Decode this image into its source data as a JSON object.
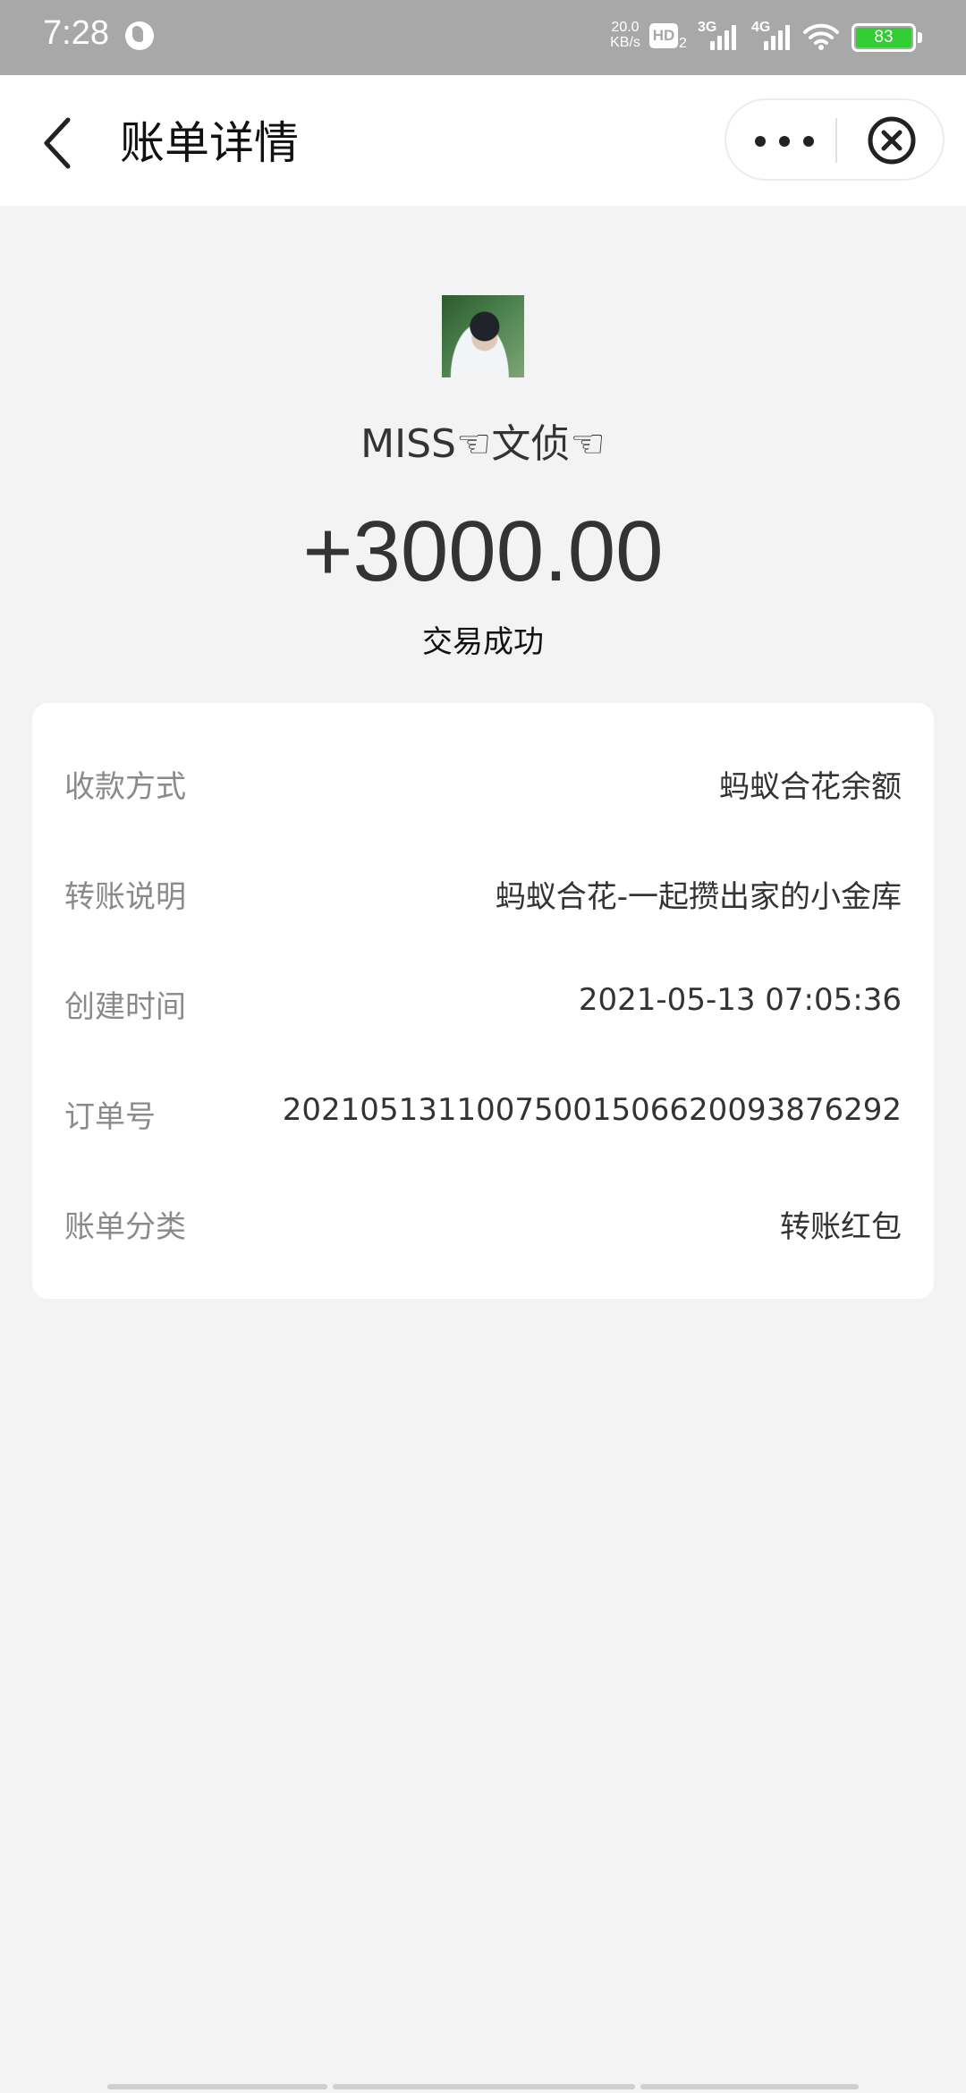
{
  "status_bar": {
    "time": "7:28",
    "net_speed_value": "20.0",
    "net_speed_unit": "KB/s",
    "hd_label": "HD",
    "hd_sub": "2",
    "signal_1": "3G",
    "signal_2": "4G",
    "battery": "83"
  },
  "nav": {
    "title": "账单详情"
  },
  "header": {
    "nickname": "MISS☜文侦☜",
    "amount": "+3000.00",
    "status": "交易成功"
  },
  "details": [
    {
      "label": "收款方式",
      "value": "蚂蚁合花余额"
    },
    {
      "label": "转账说明",
      "value": "蚂蚁合花-一起攒出家的小金库"
    },
    {
      "label": "创建时间",
      "value": "2021-05-13 07:05:36"
    },
    {
      "label": "订单号",
      "value": "2021051311007500150662009387629​2"
    },
    {
      "label": "账单分类",
      "value": "转账红包"
    }
  ],
  "colors": {
    "background": "#f3f3f3",
    "status_bar": "#a8a8a8",
    "battery": "#32cd32"
  }
}
